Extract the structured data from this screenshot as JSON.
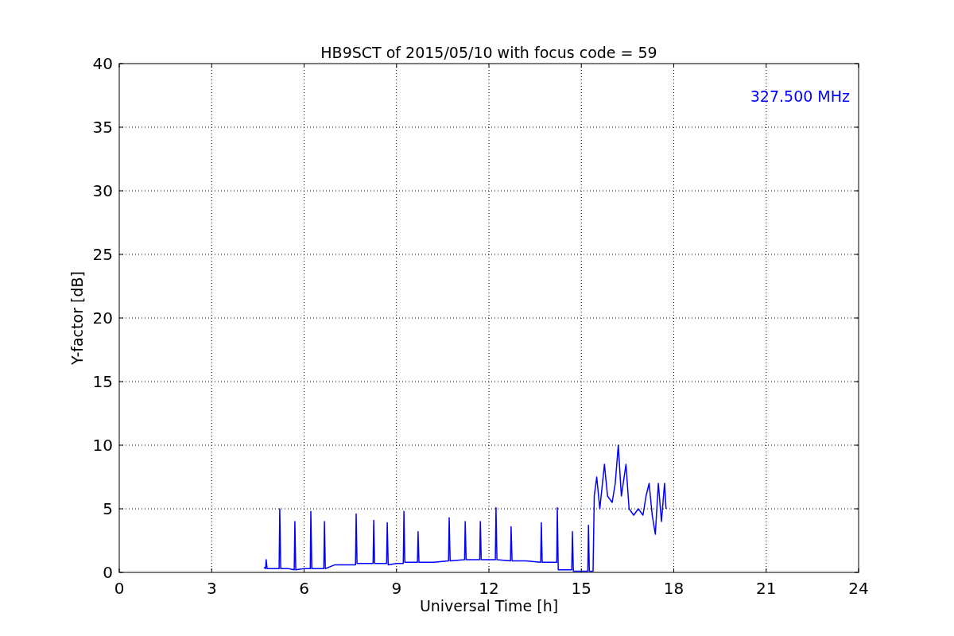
{
  "figure": {
    "chart_data": {
      "type": "line",
      "title": "HB9SCT of 2015/05/10 with focus code = 59",
      "xlabel": "Universal Time [h]",
      "ylabel": "Y-factor [dB]",
      "xlim": [
        0,
        24
      ],
      "ylim": [
        0,
        40
      ],
      "xticks": [
        0,
        3,
        6,
        9,
        12,
        15,
        18,
        21,
        24
      ],
      "yticks": [
        0,
        5,
        10,
        15,
        20,
        25,
        30,
        35,
        40
      ],
      "x": [
        4.7,
        4.75,
        4.77,
        4.8,
        5.0,
        5.19,
        5.21,
        5.24,
        5.5,
        5.68,
        5.7,
        5.73,
        6.0,
        6.2,
        6.22,
        6.25,
        6.5,
        6.64,
        6.66,
        6.69,
        7.0,
        7.3,
        7.67,
        7.69,
        7.72,
        8.0,
        8.24,
        8.26,
        8.29,
        8.68,
        8.7,
        8.73,
        9.0,
        9.22,
        9.24,
        9.27,
        9.68,
        9.7,
        9.73,
        10.2,
        10.69,
        10.71,
        10.74,
        11.21,
        11.23,
        11.26,
        11.7,
        11.72,
        11.75,
        12.21,
        12.23,
        12.26,
        12.7,
        12.72,
        12.75,
        13.2,
        13.68,
        13.7,
        13.73,
        14.2,
        14.22,
        14.25,
        14.69,
        14.71,
        14.74,
        15.21,
        15.23,
        15.26,
        15.38,
        15.42,
        15.5,
        15.6,
        15.75,
        15.85,
        16.0,
        16.1,
        16.2,
        16.3,
        16.45,
        16.55,
        16.7,
        16.85,
        17.0,
        17.1,
        17.2,
        17.3,
        17.4,
        17.5,
        17.6,
        17.7,
        17.75
      ],
      "series": [
        {
          "name": "327.500 MHz",
          "color": "#0000ff",
          "values": [
            0.4,
            0.3,
            1.0,
            0.3,
            0.3,
            0.3,
            5.0,
            0.3,
            0.3,
            0.2,
            4.0,
            0.2,
            0.3,
            0.3,
            4.8,
            0.3,
            0.3,
            0.3,
            4.0,
            0.3,
            0.6,
            0.6,
            0.6,
            4.6,
            0.7,
            0.7,
            0.7,
            4.1,
            0.7,
            0.7,
            3.9,
            0.6,
            0.7,
            0.7,
            4.8,
            0.8,
            0.8,
            3.2,
            0.8,
            0.8,
            0.9,
            4.3,
            0.9,
            1.0,
            4.0,
            1.0,
            1.0,
            4.0,
            1.0,
            1.0,
            5.1,
            1.0,
            0.9,
            3.6,
            0.9,
            0.9,
            0.8,
            3.9,
            0.8,
            0.8,
            5.1,
            0.2,
            0.2,
            3.2,
            0.1,
            0.1,
            3.7,
            0.1,
            0.1,
            6.0,
            7.5,
            5.0,
            8.5,
            6.0,
            5.5,
            7.0,
            10.0,
            6.0,
            8.5,
            5.0,
            4.5,
            5.0,
            4.5,
            6.0,
            7.0,
            4.5,
            3.0,
            7.0,
            4.0,
            7.0,
            5.0
          ]
        }
      ],
      "grid": true
    }
  }
}
